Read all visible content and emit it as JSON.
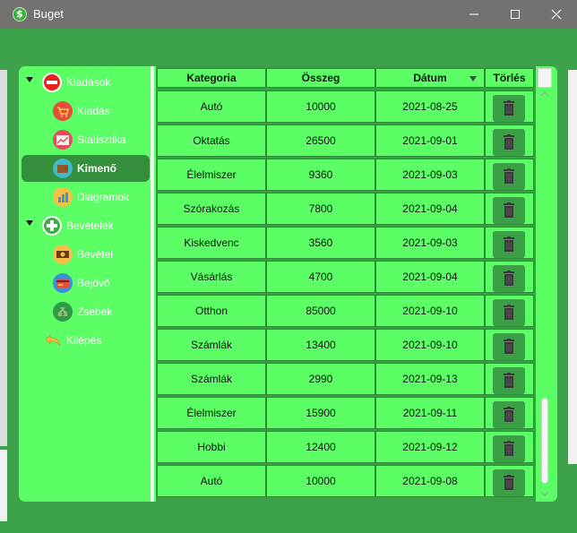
{
  "window": {
    "title": "Buget",
    "icon": "dollar-icon",
    "icon_glyph": "$",
    "controls": [
      "minimize-icon",
      "maximize-icon",
      "close-icon"
    ]
  },
  "colors": {
    "titlebar": "#757171",
    "window_bg": "#3da34a",
    "panel_bg": "#5bff65",
    "selected_bg": "#338f3c",
    "grid_line": "#2d8c36",
    "delete_button": "#3aa045"
  },
  "tree": {
    "items": [
      {
        "label": "Kiadások",
        "icon": "minus-circle-icon",
        "expanded": true,
        "selected": false
      },
      {
        "label": "Kiadás",
        "icon": "shopping-cart-icon",
        "selected": false
      },
      {
        "label": "Statisztika",
        "icon": "chart-up-icon",
        "selected": false
      },
      {
        "label": "Kimenő",
        "icon": "wallet-icon",
        "selected": true
      },
      {
        "label": "Diagramok",
        "icon": "bar-chart-icon",
        "selected": false
      },
      {
        "label": "Bevételek",
        "icon": "plus-circle-icon",
        "expanded": true,
        "selected": false
      },
      {
        "label": "Bevétel",
        "icon": "money-icon",
        "selected": false
      },
      {
        "label": "Bejövő",
        "icon": "credit-card-icon",
        "selected": false
      },
      {
        "label": "Zsebek",
        "icon": "money-bag-icon",
        "selected": false
      },
      {
        "label": "Kilépés",
        "icon": "back-arrow-icon",
        "selected": false
      }
    ]
  },
  "table": {
    "columns": [
      "Kategoria",
      "Összeg",
      "Dátum",
      "Törlés"
    ],
    "sorted_column": "Dátum",
    "rows": [
      {
        "kategoria": "Autó",
        "osszeg": "10000",
        "datum": "2021-08-25"
      },
      {
        "kategoria": "Oktatás",
        "osszeg": "26500",
        "datum": "2021-09-01"
      },
      {
        "kategoria": "Élelmiszer",
        "osszeg": "9360",
        "datum": "2021-09-03"
      },
      {
        "kategoria": "Szórakozás",
        "osszeg": "7800",
        "datum": "2021-09-04"
      },
      {
        "kategoria": "Kiskedvenc",
        "osszeg": "3560",
        "datum": "2021-09-03"
      },
      {
        "kategoria": "Vásárlás",
        "osszeg": "4700",
        "datum": "2021-09-04"
      },
      {
        "kategoria": "Otthon",
        "osszeg": "85000",
        "datum": "2021-09-10"
      },
      {
        "kategoria": "Számlák",
        "osszeg": "13400",
        "datum": "2021-09-10"
      },
      {
        "kategoria": "Számlák",
        "osszeg": "2990",
        "datum": "2021-09-13"
      },
      {
        "kategoria": "Élelmiszer",
        "osszeg": "15900",
        "datum": "2021-09-11"
      },
      {
        "kategoria": "Hobbi",
        "osszeg": "12400",
        "datum": "2021-09-12"
      },
      {
        "kategoria": "Autó",
        "osszeg": "10000",
        "datum": "2021-09-08"
      }
    ],
    "delete_icon": "trash-icon"
  }
}
